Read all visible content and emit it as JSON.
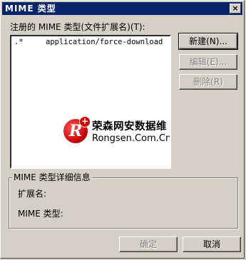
{
  "window": {
    "title": "MIME 类型",
    "close_glyph": "×"
  },
  "list_label": "注册的 MIME 类型(文件扩展名)(T):",
  "list": {
    "rows": [
      {
        "extension": ".*",
        "mime_type": "application/force-download"
      }
    ]
  },
  "side_buttons": {
    "new_label": "新建(N)...",
    "edit_label": "编辑(E)...",
    "delete_label": "删除(R)"
  },
  "watermark": {
    "logo_letter": "R",
    "plus_glyph": "+",
    "name_cn": "荣森网安数据维",
    "name_en": "Rongsen.Com.Cn"
  },
  "details": {
    "legend": "MIME 类型详细信息",
    "extension_label": "扩展名:",
    "mime_type_label": "MIME 类型:"
  },
  "footer_buttons": {
    "ok_label": "确定",
    "cancel_label": "取消"
  },
  "colors": {
    "titlebar": "#0a246a",
    "face": "#d4d0c8",
    "logo_red": "#c00000"
  }
}
